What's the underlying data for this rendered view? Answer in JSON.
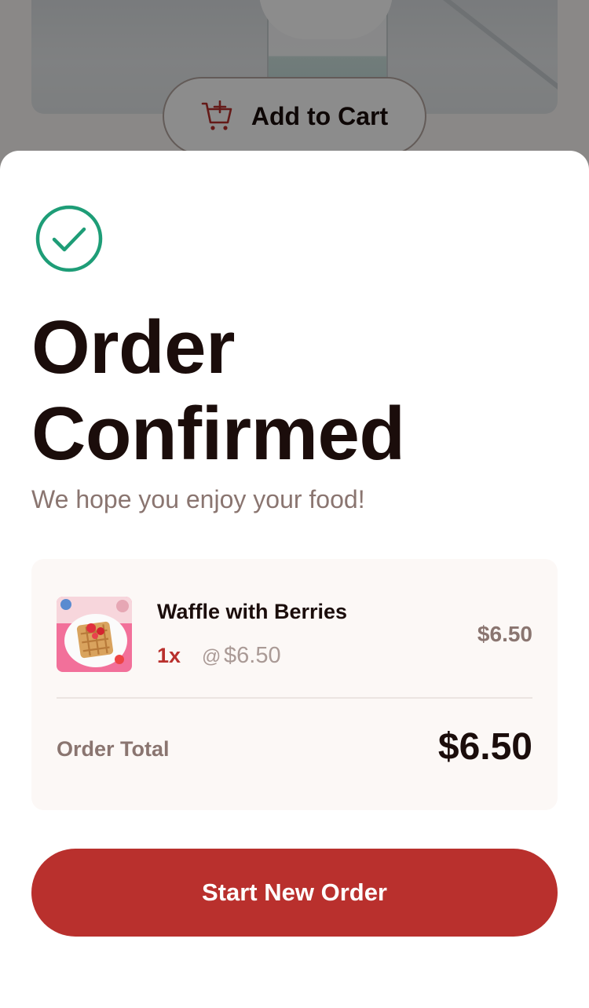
{
  "background": {
    "add_to_cart_label": "Add to Cart"
  },
  "confirmation": {
    "icon": "check-circle-icon",
    "title": "Order Confirmed",
    "subtitle": "We hope you enjoy your food!"
  },
  "order": {
    "items": [
      {
        "name": "Waffle with Berries",
        "quantity": "1x",
        "at_symbol": "@",
        "unit_price": "$6.50",
        "line_total": "$6.50"
      }
    ],
    "total_label": "Order Total",
    "total_value": "$6.50"
  },
  "actions": {
    "start_new_order": "Start New Order"
  },
  "colors": {
    "accent": "#b9302d",
    "success": "#1e9d77",
    "text_dark": "#1b0d0b",
    "text_muted": "#8a7570",
    "card_bg": "#fcf8f6"
  }
}
